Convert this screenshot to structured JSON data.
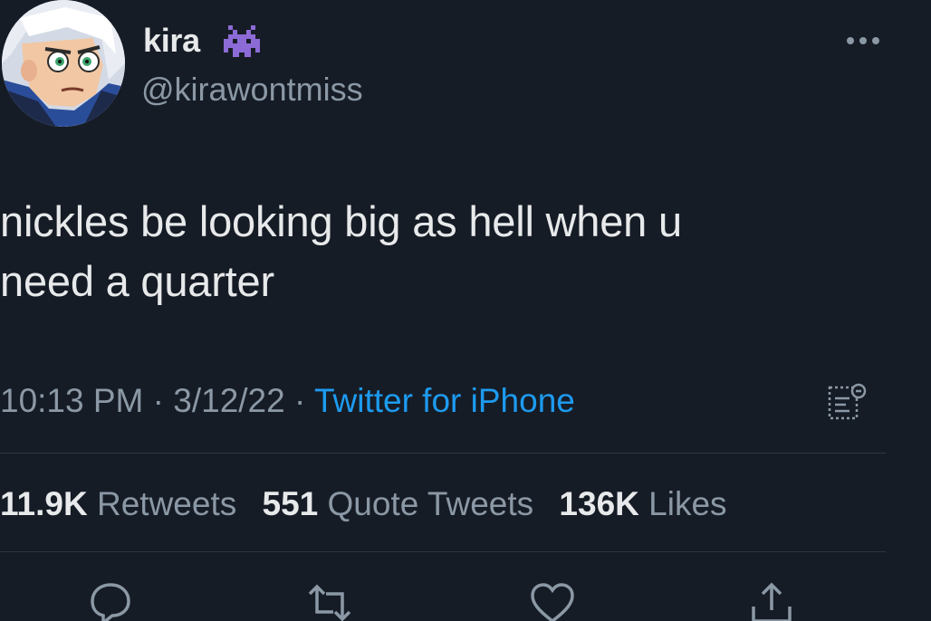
{
  "user": {
    "display_name": "kira",
    "handle": "@kirawontmiss",
    "name_emoji_icon": "alien-monster-icon"
  },
  "tweet": {
    "text_line1": "nickles be looking big as hell when u",
    "text_line2": "need a quarter"
  },
  "meta": {
    "time": "10:13 PM",
    "separator1": " · ",
    "date": "3/12/22",
    "separator2": " · ",
    "source": "Twitter for iPhone"
  },
  "stats": {
    "retweets_count": "11.9K",
    "retweets_label": "Retweets",
    "quotes_count": "551",
    "quotes_label": "Quote Tweets",
    "likes_count": "136K",
    "likes_label": "Likes"
  },
  "icons": {
    "more": "more-options-icon",
    "analytics": "analytics-icon",
    "reply": "reply-icon",
    "retweet": "retweet-icon",
    "like": "like-icon",
    "share": "share-icon"
  },
  "colors": {
    "background": "#161c26",
    "text_primary": "#e7e9ea",
    "text_secondary": "#8b98a5",
    "link": "#1d9bf0",
    "divider": "#2f3640",
    "alien": "#8c6bd6"
  }
}
